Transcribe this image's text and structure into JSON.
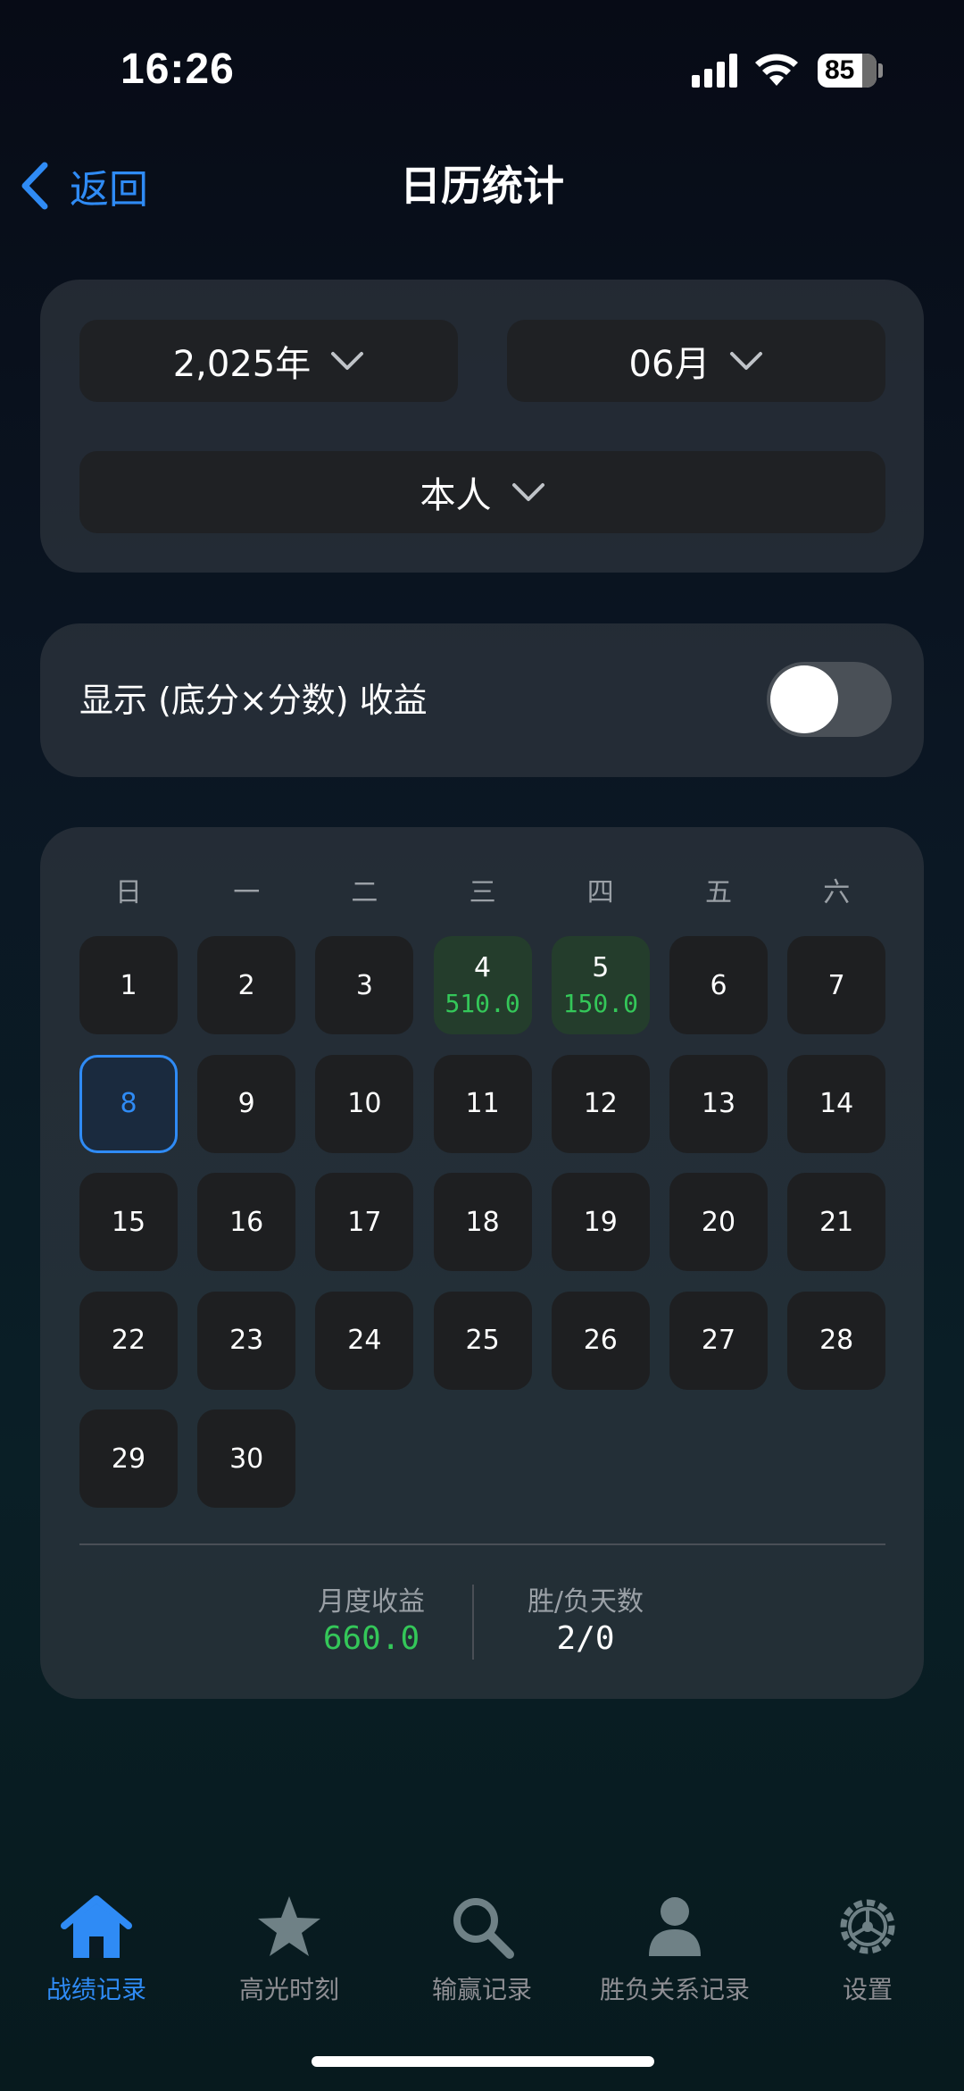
{
  "status": {
    "time": "16:26",
    "battery": "85"
  },
  "nav": {
    "back_label": "返回",
    "title": "日历统计"
  },
  "filters": {
    "year": "2,025年",
    "month": "06月",
    "person": "本人"
  },
  "toggle": {
    "label": "显示 (底分×分数) 收益",
    "on": false
  },
  "calendar": {
    "weekdays": [
      "日",
      "一",
      "二",
      "三",
      "四",
      "五",
      "六"
    ],
    "days": [
      {
        "d": "1"
      },
      {
        "d": "2"
      },
      {
        "d": "3"
      },
      {
        "d": "4",
        "amount": "510.0"
      },
      {
        "d": "5",
        "amount": "150.0"
      },
      {
        "d": "6"
      },
      {
        "d": "7"
      },
      {
        "d": "8",
        "today": true
      },
      {
        "d": "9"
      },
      {
        "d": "10"
      },
      {
        "d": "11"
      },
      {
        "d": "12"
      },
      {
        "d": "13"
      },
      {
        "d": "14"
      },
      {
        "d": "15"
      },
      {
        "d": "16"
      },
      {
        "d": "17"
      },
      {
        "d": "18"
      },
      {
        "d": "19"
      },
      {
        "d": "20"
      },
      {
        "d": "21"
      },
      {
        "d": "22"
      },
      {
        "d": "23"
      },
      {
        "d": "24"
      },
      {
        "d": "25"
      },
      {
        "d": "26"
      },
      {
        "d": "27"
      },
      {
        "d": "28"
      },
      {
        "d": "29"
      },
      {
        "d": "30"
      }
    ]
  },
  "summary": {
    "income_label": "月度收益",
    "income_value": "660.0",
    "record_label": "胜/负天数",
    "record_value": "2/0"
  },
  "tabs": [
    {
      "label": "战绩记录",
      "icon": "home-icon",
      "active": true
    },
    {
      "label": "高光时刻",
      "icon": "star-icon",
      "active": false
    },
    {
      "label": "输赢记录",
      "icon": "search-icon",
      "active": false
    },
    {
      "label": "胜负关系记录",
      "icon": "person-icon",
      "active": false
    },
    {
      "label": "设置",
      "icon": "gear-icon",
      "active": false
    }
  ],
  "colors": {
    "accent": "#2f8bf5",
    "positive": "#34c759"
  }
}
